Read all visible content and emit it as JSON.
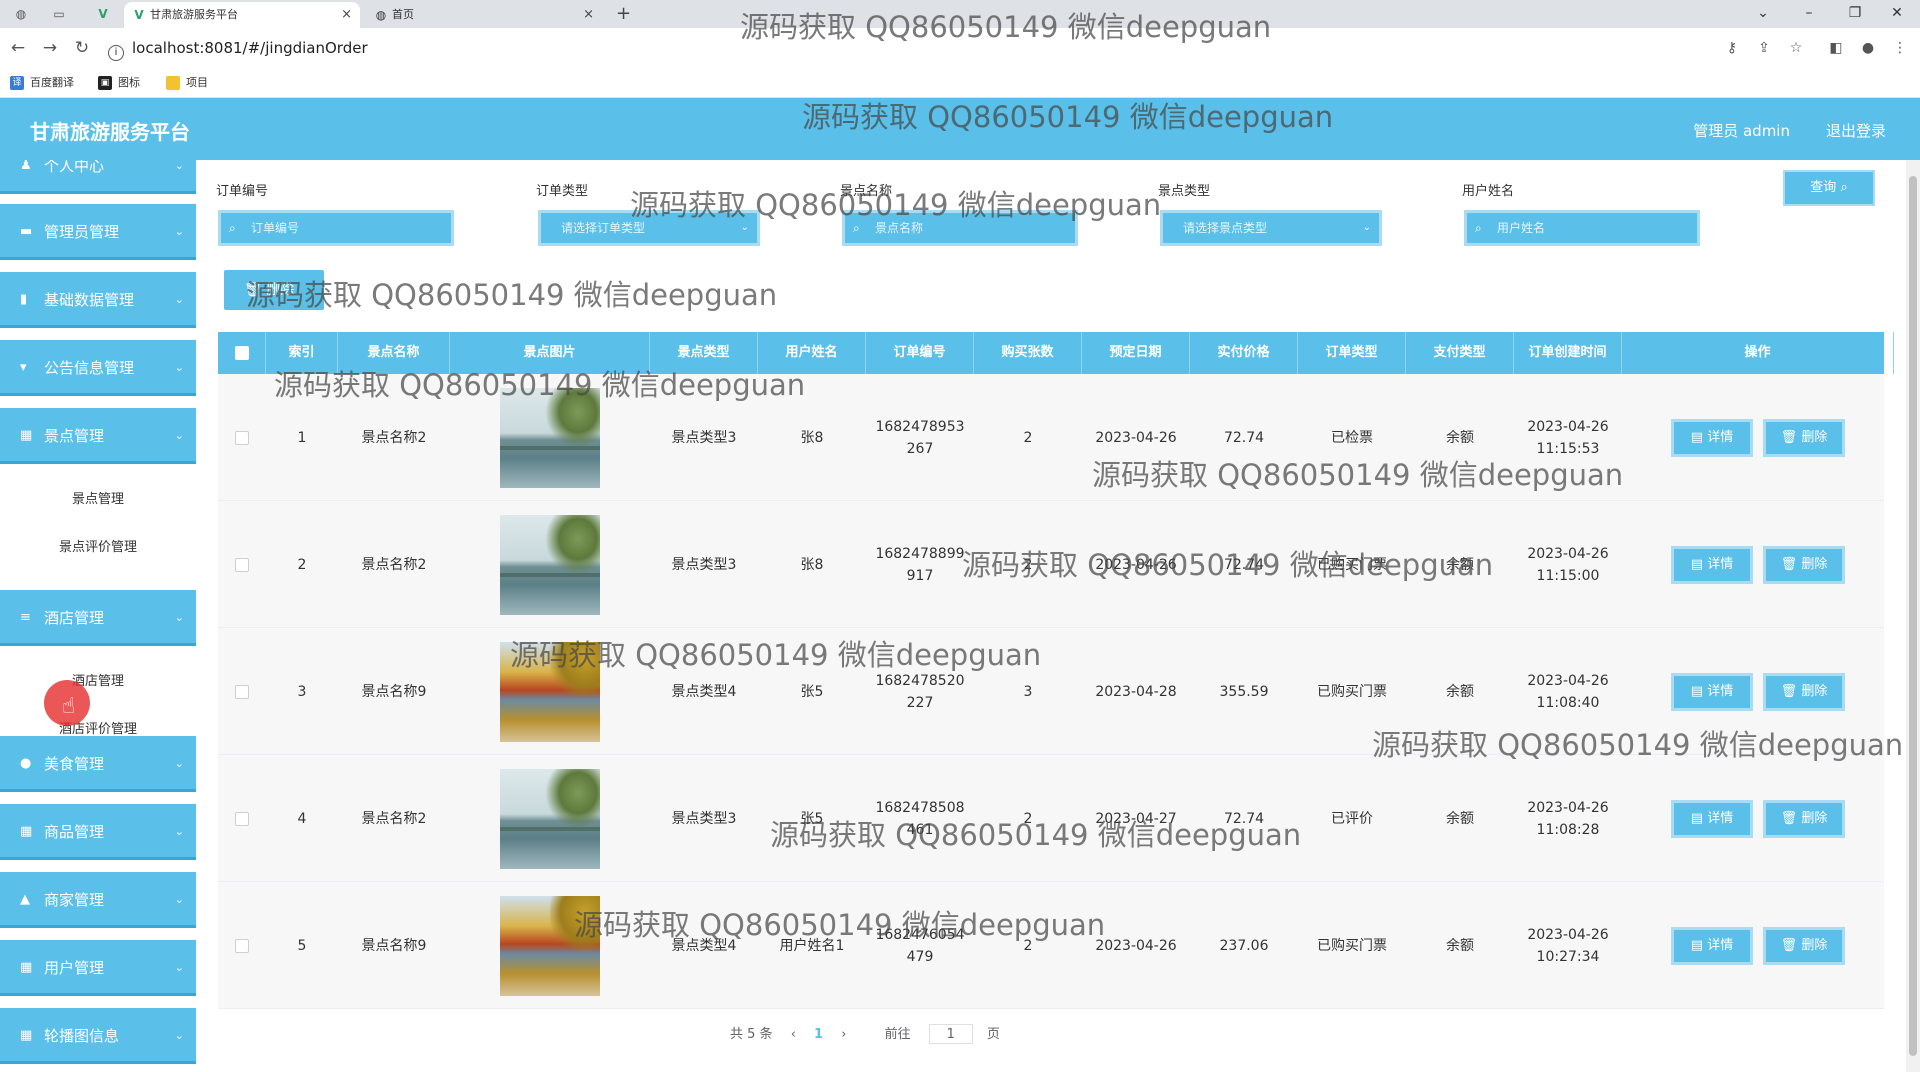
{
  "browser": {
    "tabs": [
      {
        "label": "甘肃旅游服务平台",
        "close": "×"
      },
      {
        "label": "首页",
        "close": "×"
      }
    ],
    "new_tab": "+",
    "url": "localhost:8081/#/jingdianOrder",
    "bookmarks": [
      "百度翻译",
      "图标",
      "项目"
    ]
  },
  "header": {
    "title": "甘肃旅游服务平台",
    "user": "管理员 admin",
    "logout": "退出登录"
  },
  "sidebar": {
    "menus": [
      {
        "label": "个人中心"
      },
      {
        "label": "管理员管理"
      },
      {
        "label": "基础数据管理"
      },
      {
        "label": "公告信息管理"
      },
      {
        "label": "景点管理"
      },
      {
        "label": "酒店管理"
      },
      {
        "label": "美食管理"
      },
      {
        "label": "商品管理"
      },
      {
        "label": "商家管理"
      },
      {
        "label": "用户管理"
      },
      {
        "label": "轮播图信息"
      }
    ],
    "submenus": [
      {
        "label": "景点管理"
      },
      {
        "label": "景点评价管理"
      },
      {
        "label": "酒店管理"
      },
      {
        "label": "酒店评价管理"
      }
    ]
  },
  "search": {
    "fields": [
      {
        "label": "订单编号",
        "placeholder": "订单编号"
      },
      {
        "label": "订单类型",
        "placeholder": "请选择订单类型"
      },
      {
        "label": "景点名称",
        "placeholder": "景点名称"
      },
      {
        "label": "景点类型",
        "placeholder": "请选择景点类型"
      },
      {
        "label": "用户姓名",
        "placeholder": "用户姓名"
      }
    ],
    "query_button": "查询"
  },
  "delete_button": "删除",
  "table": {
    "headers": [
      "索引",
      "景点名称",
      "景点图片",
      "景点类型",
      "用户姓名",
      "订单编号",
      "购买张数",
      "预定日期",
      "实付价格",
      "订单类型",
      "支付类型",
      "订单创建时间",
      "操作"
    ],
    "rows": [
      {
        "index": "1",
        "name": "景点名称2",
        "image": "lake",
        "type": "景点类型3",
        "user": "张8",
        "order_no_1": "1682478953",
        "order_no_2": "267",
        "qty": "2",
        "date": "2023-04-26",
        "price": "72.74",
        "order_type": "已检票",
        "pay_type": "余额",
        "created_1": "2023-04-26",
        "created_2": "11:15:53"
      },
      {
        "index": "2",
        "name": "景点名称2",
        "image": "lake",
        "type": "景点类型3",
        "user": "张8",
        "order_no_1": "1682478899",
        "order_no_2": "917",
        "qty": "2",
        "date": "2023-04-26",
        "price": "72.74",
        "order_type": "已购买门票",
        "pay_type": "余额",
        "created_1": "2023-04-26",
        "created_2": "11:15:00"
      },
      {
        "index": "3",
        "name": "景点名称9",
        "image": "town",
        "type": "景点类型4",
        "user": "张5",
        "order_no_1": "1682478520",
        "order_no_2": "227",
        "qty": "3",
        "date": "2023-04-28",
        "price": "355.59",
        "order_type": "已购买门票",
        "pay_type": "余额",
        "created_1": "2023-04-26",
        "created_2": "11:08:40"
      },
      {
        "index": "4",
        "name": "景点名称2",
        "image": "lake",
        "type": "景点类型3",
        "user": "张5",
        "order_no_1": "1682478508",
        "order_no_2": "461",
        "qty": "2",
        "date": "2023-04-27",
        "price": "72.74",
        "order_type": "已评价",
        "pay_type": "余额",
        "created_1": "2023-04-26",
        "created_2": "11:08:28"
      },
      {
        "index": "5",
        "name": "景点名称9",
        "image": "town",
        "type": "景点类型4",
        "user": "用户姓名1",
        "order_no_1": "1682476054",
        "order_no_2": "479",
        "qty": "2",
        "date": "2023-04-26",
        "price": "237.06",
        "order_type": "已购买门票",
        "pay_type": "余额",
        "created_1": "2023-04-26",
        "created_2": "10:27:34"
      }
    ],
    "detail_label": "详情",
    "delete_label": "删除"
  },
  "pagination": {
    "total": "共 5 条",
    "current": "1",
    "goto": "前往",
    "goto_value": "1",
    "page_suffix": "页"
  },
  "watermark": "源码获取 QQ86050149 微信deepguan"
}
